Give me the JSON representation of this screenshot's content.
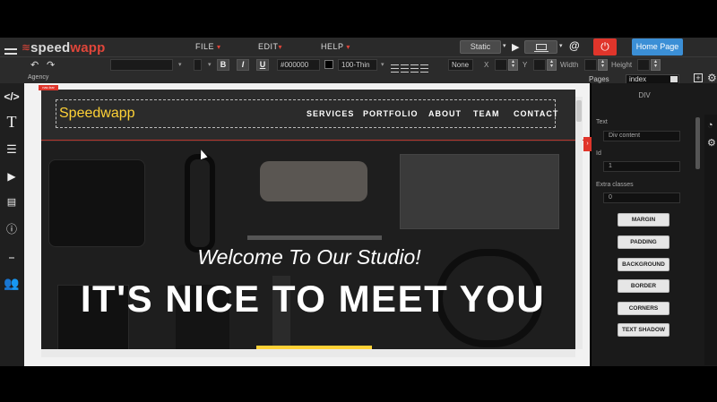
{
  "app": {
    "logo_prefix": "speed",
    "logo_suffix": "wapp",
    "menu": [
      {
        "label": "FILE"
      },
      {
        "label": "EDIT"
      },
      {
        "label": "HELP"
      }
    ],
    "mode": "Static",
    "home_button": "Home Page"
  },
  "toolbar": {
    "bold": "B",
    "italic": "I",
    "underline": "U",
    "color_value": "#000000",
    "font_weight": "100-Thin",
    "float_value": "None",
    "x_label": "X",
    "y_label": "Y",
    "width_label": "Width",
    "height_label": "Height"
  },
  "subbar": {
    "project": "Agency",
    "pages_label": "Pages",
    "page_selected": "index"
  },
  "site": {
    "tag": "nav-bar",
    "brand": "Speedwapp",
    "nav": [
      "SERVICES",
      "PORTFOLIO",
      "ABOUT",
      "TEAM",
      "CONTACT"
    ],
    "welcome": "Welcome To Our Studio!",
    "headline": "IT'S NICE TO MEET YOU"
  },
  "panel": {
    "title": "DIV",
    "text_label": "Text",
    "text_value": "Div content",
    "id_label": "Id",
    "id_value": "1",
    "classes_label": "Extra classes",
    "classes_value": "0",
    "buttons": [
      "MARGIN",
      "PADDING",
      "BACKGROUND",
      "BORDER",
      "CORNERS",
      "TEXT SHADOW"
    ]
  },
  "colors": {
    "accent": "#e0352b",
    "brand_yellow": "#fed136",
    "home_blue": "#3b8fd6"
  },
  "icons": [
    "menu-icon",
    "undo-icon",
    "redo-icon",
    "play-icon",
    "laptop-icon",
    "at-icon",
    "power-icon",
    "code-icon",
    "text-icon",
    "list-icon",
    "video-icon",
    "html-icon",
    "info-icon",
    "slider-icon",
    "team-icon",
    "add-page-icon",
    "gear-icon",
    "help-icon"
  ]
}
